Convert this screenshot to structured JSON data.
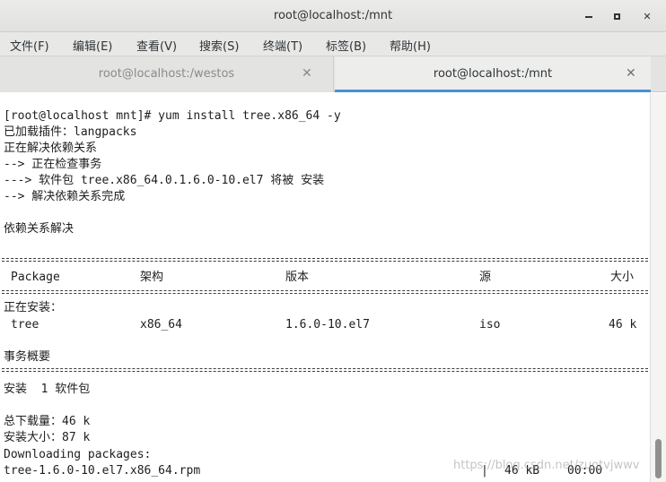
{
  "window": {
    "title": "root@localhost:/mnt",
    "minimize_glyph": "▬",
    "maximize_glyph": "■",
    "close_glyph": "✕"
  },
  "menu": {
    "file": "文件(F)",
    "edit": "编辑(E)",
    "view": "查看(V)",
    "search": "搜索(S)",
    "terminal": "终端(T)",
    "tabs": "标签(B)",
    "help": "帮助(H)"
  },
  "tabs": [
    {
      "label": "root@localhost:/westos",
      "close": "✕",
      "active": false
    },
    {
      "label": "root@localhost:/mnt",
      "close": "✕",
      "active": true
    }
  ],
  "terminal": {
    "lines": {
      "l1": "[root@localhost mnt]# yum install tree.x86_64 -y",
      "l2": "已加载插件：langpacks",
      "l3": "正在解决依赖关系",
      "l4": "--> 正在检查事务",
      "l5": "---> 软件包 tree.x86_64.0.1.6.0-10.el7 将被 安装",
      "l6": "--> 解决依赖关系完成",
      "l7": "依赖关系解决",
      "l8": "正在安装：",
      "l9": "事务概要",
      "l10": "安装  1 软件包",
      "l11": "总下载量：46 k",
      "l12": "安装大小：87 k",
      "l13": "Downloading packages:",
      "l14": "tree-1.6.0-10.el7.x86_64.rpm"
    },
    "table_headers": {
      "package": "Package",
      "arch": "架构",
      "version": "版本",
      "repo": "源",
      "size": "大小"
    },
    "package_row": {
      "name": "tree",
      "arch": "x86_64",
      "version": "1.6.0-10.el7",
      "repo": "iso",
      "size": "46 k"
    },
    "progress": {
      "separator": "|",
      "size": "46 kB",
      "time": "00:00"
    }
  },
  "watermark": "https://blog.csdn.net/zuotvjwwv"
}
